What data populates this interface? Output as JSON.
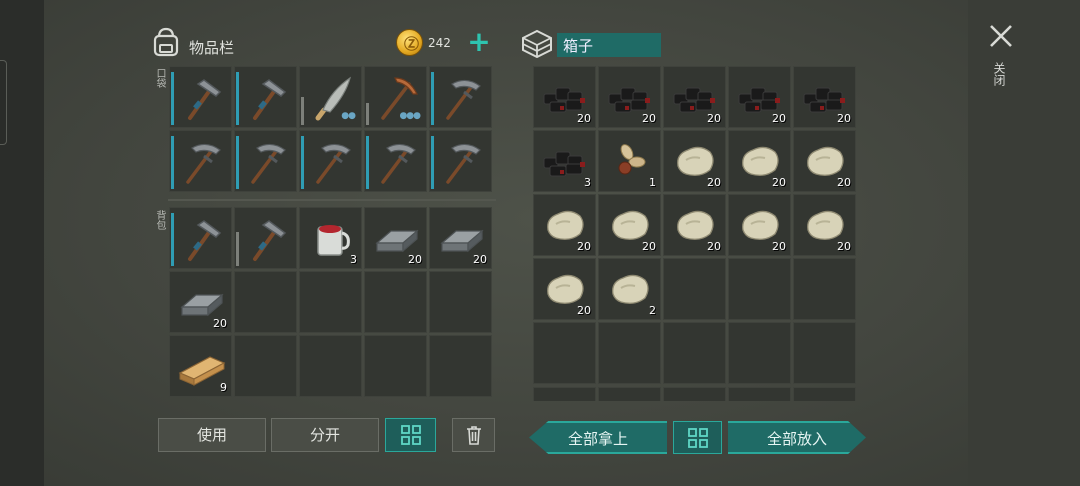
{
  "inventory": {
    "title": "物品栏",
    "coins": "242",
    "pocket_label": "口袋",
    "backpack_label": "背包",
    "pocket": [
      {
        "item": "hammer",
        "dur": 0.95,
        "count": ""
      },
      {
        "item": "hammer",
        "dur": 0.95,
        "count": ""
      },
      {
        "item": "machete",
        "dur": 0.5,
        "count": "",
        "gray": true,
        "dots": "●●"
      },
      {
        "item": "copper-pickaxe",
        "dur": 0.4,
        "count": "",
        "gray": true,
        "dots": "●●●"
      },
      {
        "item": "pickaxe",
        "dur": 0.95,
        "count": ""
      },
      {
        "item": "pickaxe",
        "dur": 0.95,
        "count": ""
      },
      {
        "item": "pickaxe",
        "dur": 0.95,
        "count": ""
      },
      {
        "item": "pickaxe",
        "dur": 0.95,
        "count": ""
      },
      {
        "item": "pickaxe",
        "dur": 0.95,
        "count": ""
      },
      {
        "item": "pickaxe",
        "dur": 0.95,
        "count": ""
      }
    ],
    "backpack": [
      {
        "item": "hammer",
        "dur": 0.95,
        "count": ""
      },
      {
        "item": "hammer",
        "dur": 0.6,
        "count": "",
        "gray": true
      },
      {
        "item": "mug",
        "count": "3"
      },
      {
        "item": "iron-ingot",
        "count": "20"
      },
      {
        "item": "iron-ingot",
        "count": "20"
      },
      {
        "item": "iron-ingot",
        "count": "20"
      },
      {
        "item": "",
        "count": ""
      },
      {
        "item": "",
        "count": ""
      },
      {
        "item": "",
        "count": ""
      },
      {
        "item": "",
        "count": ""
      },
      {
        "item": "plank",
        "count": "9"
      },
      {
        "item": "",
        "count": ""
      },
      {
        "item": "",
        "count": ""
      },
      {
        "item": "",
        "count": ""
      },
      {
        "item": "",
        "count": ""
      }
    ],
    "buttons": {
      "use": "使用",
      "split": "分开"
    }
  },
  "chest": {
    "title": "箱子",
    "slots": [
      {
        "item": "coal",
        "count": "20"
      },
      {
        "item": "coal",
        "count": "20"
      },
      {
        "item": "coal",
        "count": "20"
      },
      {
        "item": "coal",
        "count": "20"
      },
      {
        "item": "coal",
        "count": "20"
      },
      {
        "item": "coal",
        "count": "3"
      },
      {
        "item": "seeds",
        "count": "1"
      },
      {
        "item": "stone",
        "count": "20"
      },
      {
        "item": "stone",
        "count": "20"
      },
      {
        "item": "stone",
        "count": "20"
      },
      {
        "item": "stone",
        "count": "20"
      },
      {
        "item": "stone",
        "count": "20"
      },
      {
        "item": "stone",
        "count": "20"
      },
      {
        "item": "stone",
        "count": "20"
      },
      {
        "item": "stone",
        "count": "20"
      },
      {
        "item": "stone",
        "count": "20"
      },
      {
        "item": "stone",
        "count": "2"
      },
      {
        "item": "",
        "count": ""
      },
      {
        "item": "",
        "count": ""
      },
      {
        "item": "",
        "count": ""
      },
      {
        "item": "",
        "count": ""
      },
      {
        "item": "",
        "count": ""
      },
      {
        "item": "",
        "count": ""
      },
      {
        "item": "",
        "count": ""
      },
      {
        "item": "",
        "count": ""
      }
    ],
    "buttons": {
      "take_all": "全部拿上",
      "put_all": "全部放入"
    }
  },
  "close_label": "关闭",
  "colors": {
    "accent": "#2aa89b",
    "teal_fill": "#1f6b66",
    "slot_bg": "#333631"
  }
}
